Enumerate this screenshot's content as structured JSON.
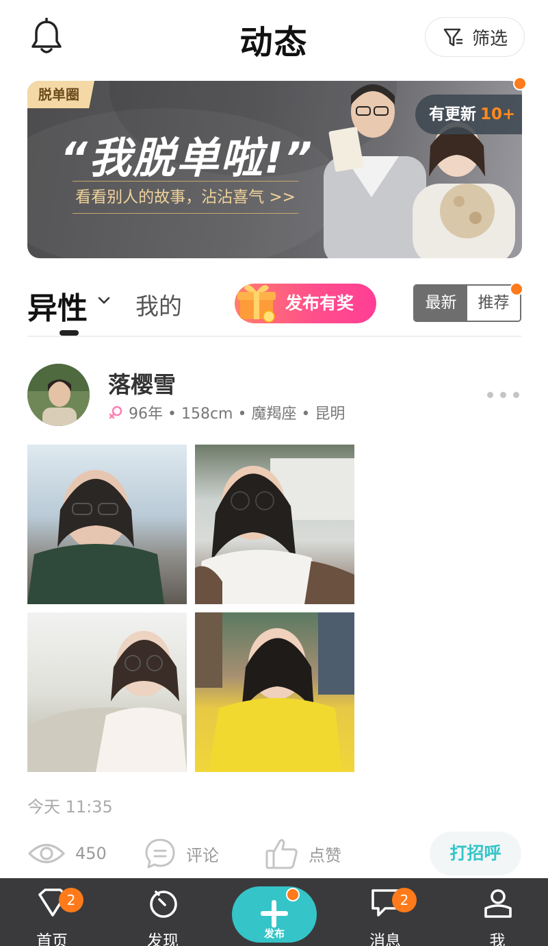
{
  "header": {
    "title": "动态",
    "filter_label": "筛选"
  },
  "banner": {
    "tag": "脱单圈",
    "headline": "“我脱单啦!”",
    "subtitle": "看看别人的故事，沾沾喜气 >>",
    "update_label": "有更新",
    "update_count": "10+"
  },
  "tabs": {
    "gender_tab": "异性",
    "mine_tab": "我的",
    "reward_button": "发布有奖",
    "sort_latest": "最新",
    "sort_recommend": "推荐"
  },
  "post": {
    "username": "落樱雪",
    "meta": "96年 • 158cm • 魔羯座 • 昆明",
    "time": "今天  11:35",
    "views": "450",
    "comment_label": "评论",
    "like_label": "点赞",
    "greet_button": "打招呼"
  },
  "bottom_nav": {
    "home": "首页",
    "home_badge": "2",
    "discover": "发现",
    "publish": "发布",
    "messages": "消息",
    "messages_badge": "2",
    "me": "我"
  },
  "colors": {
    "accent_teal": "#35c4c8",
    "badge_orange": "#ff7a1a",
    "reward_pink": "#ff4f8b"
  }
}
